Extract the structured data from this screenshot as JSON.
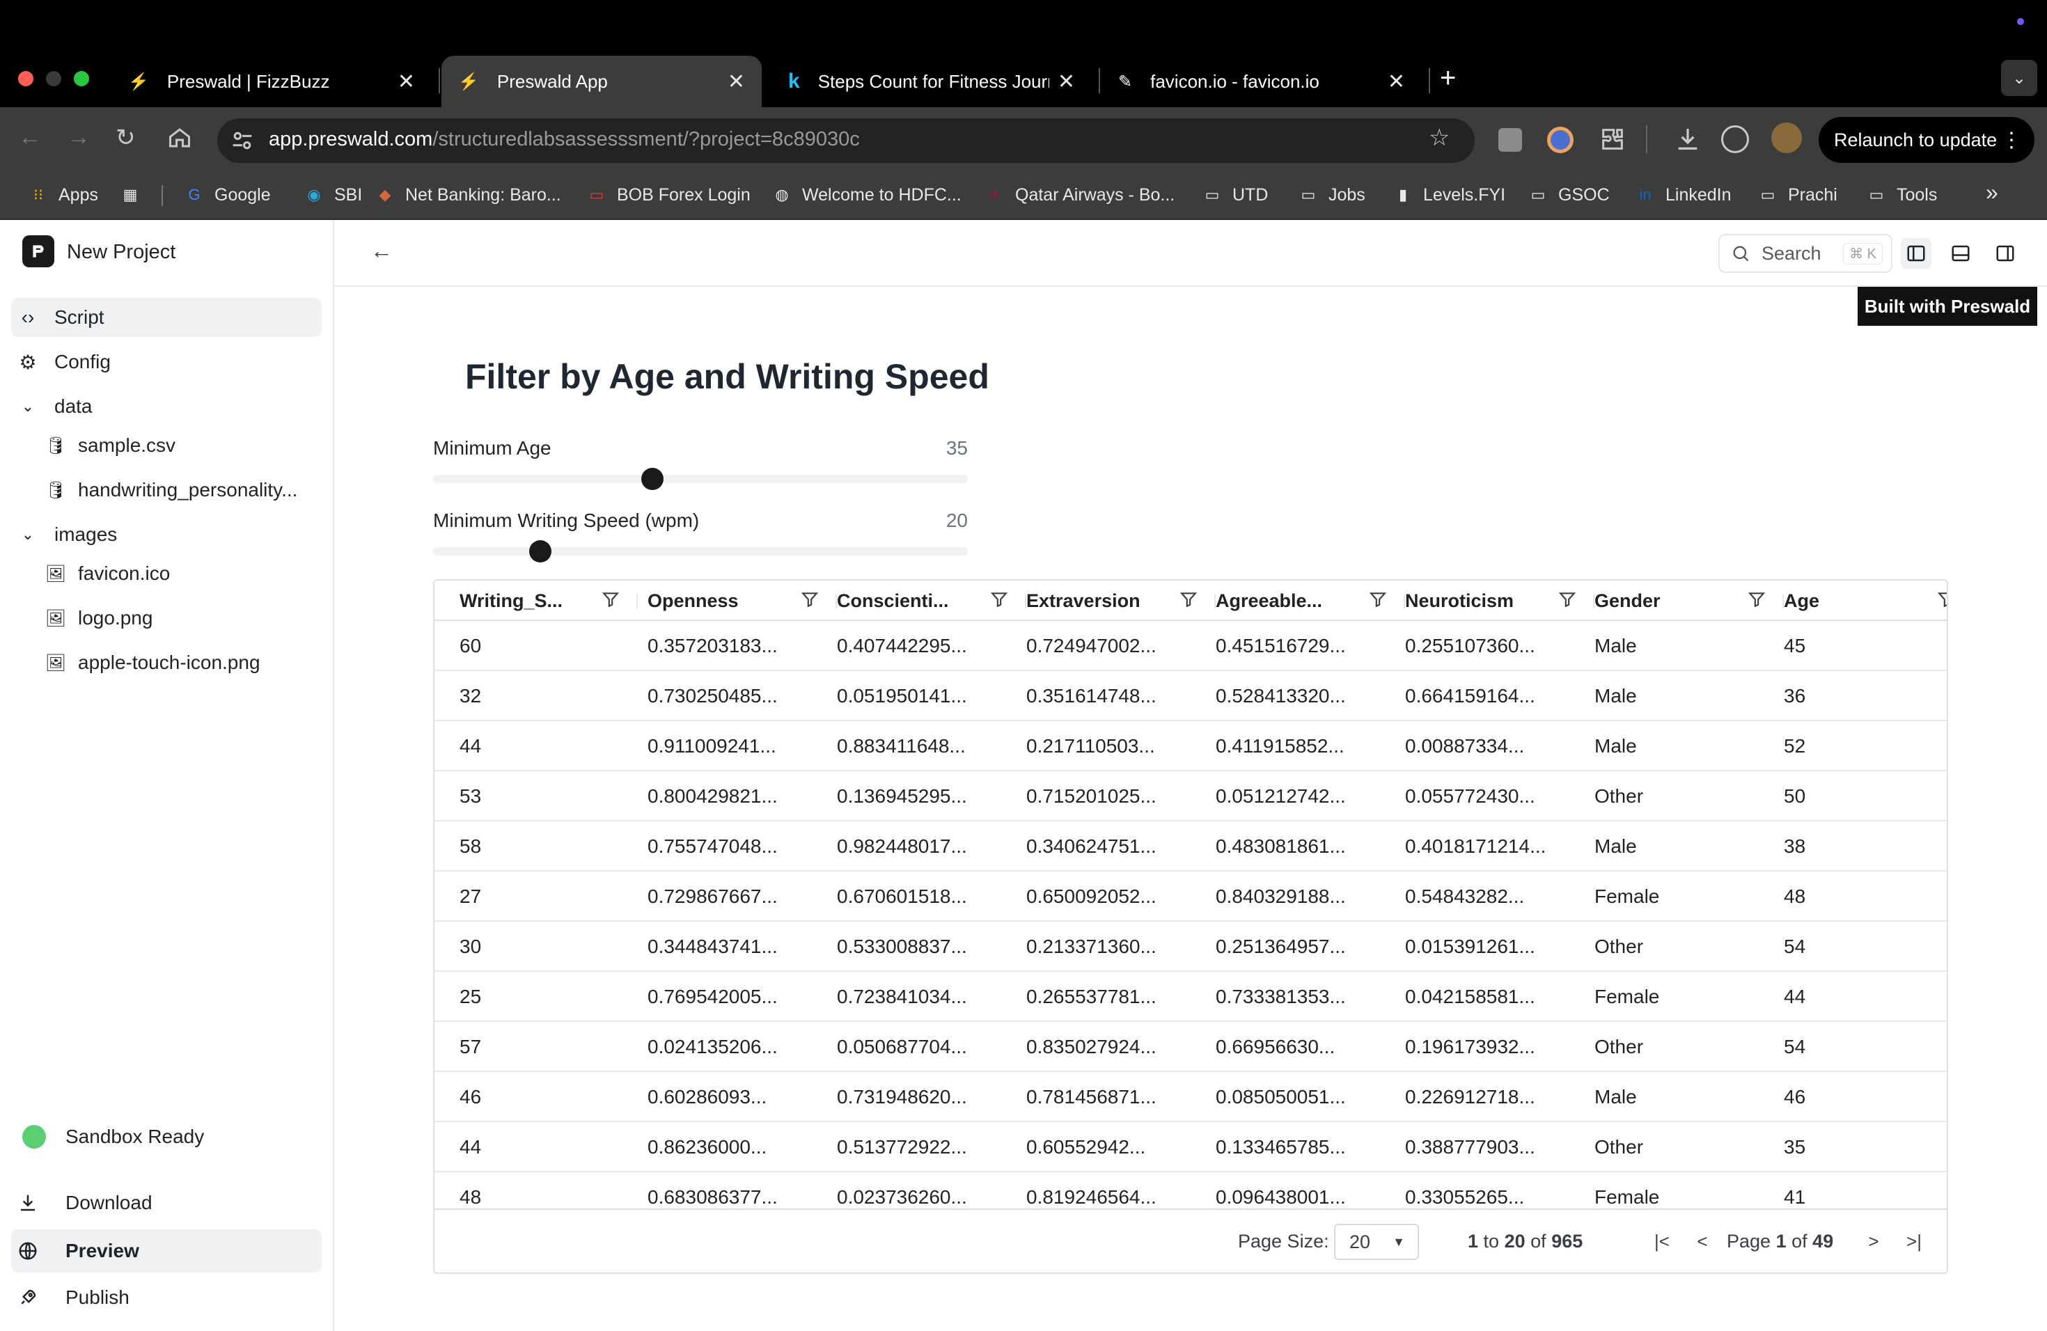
{
  "browser": {
    "tabs": [
      {
        "title": "Preswald | FizzBuzz",
        "active": false
      },
      {
        "title": "Preswald App",
        "active": true
      },
      {
        "title": "Steps Count for Fitness Journ",
        "active": false
      },
      {
        "title": "favicon.io - favicon.io",
        "active": false
      }
    ],
    "url": {
      "host": "app.preswald.com",
      "path": "/structuredlabsassesssment/?project=8c89030c"
    },
    "relaunch_label": "Relaunch to update",
    "bookmarks": [
      {
        "label": "Apps",
        "icon": "apps-grid-icon"
      },
      {
        "label": "",
        "icon": "tab-groups-icon"
      },
      {
        "label": "Google",
        "icon": "google-icon"
      },
      {
        "label": "SBI",
        "icon": "sbi-icon"
      },
      {
        "label": "Net Banking: Baro...",
        "icon": "bank-icon"
      },
      {
        "label": "BOB Forex Login",
        "icon": "forex-icon"
      },
      {
        "label": "Welcome to HDFC...",
        "icon": "globe-icon"
      },
      {
        "label": "Qatar Airways - Bo...",
        "icon": "airline-icon"
      },
      {
        "label": "UTD",
        "icon": "folder-icon"
      },
      {
        "label": "Jobs",
        "icon": "folder-icon"
      },
      {
        "label": "Levels.FYI",
        "icon": "levels-icon"
      },
      {
        "label": "GSOC",
        "icon": "folder-icon"
      },
      {
        "label": "LinkedIn",
        "icon": "linkedin-icon"
      },
      {
        "label": "Prachi",
        "icon": "folder-icon"
      },
      {
        "label": "Tools",
        "icon": "folder-icon"
      }
    ]
  },
  "sidebar": {
    "project_name": "New Project",
    "items": [
      {
        "label": "Script",
        "icon": "code-icon"
      },
      {
        "label": "Config",
        "icon": "gear-icon"
      },
      {
        "label": "data",
        "icon": "chevron-down-icon"
      },
      {
        "label": "sample.csv",
        "icon": "database-icon"
      },
      {
        "label": "handwriting_personality...",
        "icon": "database-icon"
      },
      {
        "label": "images",
        "icon": "chevron-down-icon"
      },
      {
        "label": "favicon.ico",
        "icon": "image-icon"
      },
      {
        "label": "logo.png",
        "icon": "image-icon"
      },
      {
        "label": "apple-touch-icon.png",
        "icon": "image-icon"
      }
    ],
    "status": "Sandbox Ready",
    "actions": [
      {
        "label": "Download",
        "icon": "download-icon"
      },
      {
        "label": "Preview",
        "icon": "globe-icon"
      },
      {
        "label": "Publish",
        "icon": "rocket-icon"
      }
    ]
  },
  "header": {
    "search_label": "Search",
    "search_shortcut": "⌘ K",
    "built_with": "Built with Preswald"
  },
  "page": {
    "title": "Filter by Age and Writing Speed",
    "sliders": [
      {
        "label": "Minimum Age",
        "value": "35",
        "fraction": 0.41
      },
      {
        "label": "Minimum Writing Speed (wpm)",
        "value": "20",
        "fraction": 0.2
      }
    ]
  },
  "table": {
    "columns": [
      "Writing_S...",
      "Openness",
      "Conscienti...",
      "Extraversion",
      "Agreeable...",
      "Neuroticism",
      "Gender",
      "Age"
    ],
    "rows": [
      [
        "60",
        "0.357203183...",
        "0.407442295...",
        "0.724947002...",
        "0.451516729...",
        "0.255107360...",
        "Male",
        "45"
      ],
      [
        "32",
        "0.730250485...",
        "0.051950141...",
        "0.351614748...",
        "0.528413320...",
        "0.664159164...",
        "Male",
        "36"
      ],
      [
        "44",
        "0.911009241...",
        "0.883411648...",
        "0.217110503...",
        "0.411915852...",
        "0.00887334...",
        "Male",
        "52"
      ],
      [
        "53",
        "0.800429821...",
        "0.136945295...",
        "0.715201025...",
        "0.051212742...",
        "0.055772430...",
        "Other",
        "50"
      ],
      [
        "58",
        "0.755747048...",
        "0.982448017...",
        "0.340624751...",
        "0.483081861...",
        "0.4018171214...",
        "Male",
        "38"
      ],
      [
        "27",
        "0.729867667...",
        "0.670601518...",
        "0.650092052...",
        "0.840329188...",
        "0.54843282...",
        "Female",
        "48"
      ],
      [
        "30",
        "0.344843741...",
        "0.533008837...",
        "0.213371360...",
        "0.251364957...",
        "0.015391261...",
        "Other",
        "54"
      ],
      [
        "25",
        "0.769542005...",
        "0.723841034...",
        "0.265537781...",
        "0.733381353...",
        "0.042158581...",
        "Female",
        "44"
      ],
      [
        "57",
        "0.024135206...",
        "0.050687704...",
        "0.835027924...",
        "0.66956630...",
        "0.196173932...",
        "Other",
        "54"
      ],
      [
        "46",
        "0.60286093...",
        "0.731948620...",
        "0.781456871...",
        "0.085050051...",
        "0.226912718...",
        "Male",
        "46"
      ],
      [
        "44",
        "0.86236000...",
        "0.513772922...",
        "0.60552942...",
        "0.133465785...",
        "0.388777903...",
        "Other",
        "35"
      ],
      [
        "48",
        "0.683086377...",
        "0.023736260...",
        "0.819246564...",
        "0.096438001...",
        "0.33055265...",
        "Female",
        "41"
      ]
    ],
    "footer": {
      "page_size_label": "Page Size:",
      "page_size": "20",
      "range_from": "1",
      "range_to_word": "to",
      "range_to": "20",
      "range_of_word": "of",
      "total": "965",
      "page_word": "Page",
      "page": "1",
      "page_of_word": "of",
      "pages": "49"
    }
  }
}
